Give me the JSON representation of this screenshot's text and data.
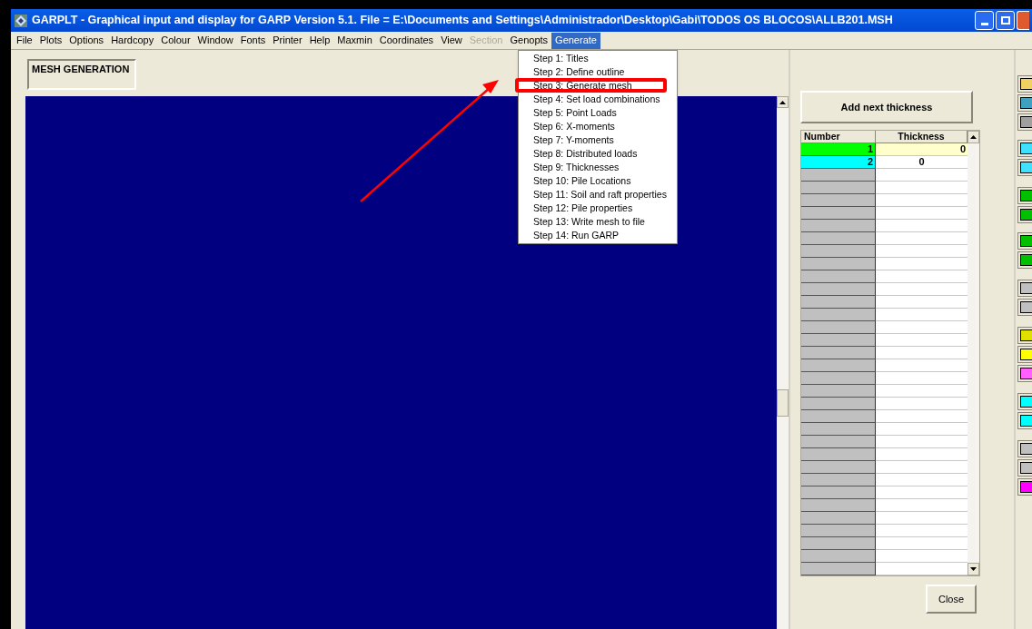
{
  "window": {
    "title": "GARPLT - Graphical input and display for GARP Version 5.1. File = E:\\Documents and Settings\\Administrador\\Desktop\\Gabi\\TODOS OS BLOCOS\\ALLB201.MSH"
  },
  "menu": [
    {
      "label": "File",
      "disabled": false,
      "selected": false
    },
    {
      "label": "Plots",
      "disabled": false,
      "selected": false
    },
    {
      "label": "Options",
      "disabled": false,
      "selected": false
    },
    {
      "label": "Hardcopy",
      "disabled": false,
      "selected": false
    },
    {
      "label": "Colour",
      "disabled": false,
      "selected": false
    },
    {
      "label": "Window",
      "disabled": false,
      "selected": false
    },
    {
      "label": "Fonts",
      "disabled": false,
      "selected": false
    },
    {
      "label": "Printer",
      "disabled": false,
      "selected": false
    },
    {
      "label": "Help",
      "disabled": false,
      "selected": false
    },
    {
      "label": "Maxmin",
      "disabled": false,
      "selected": false
    },
    {
      "label": "Coordinates",
      "disabled": false,
      "selected": false
    },
    {
      "label": "View",
      "disabled": false,
      "selected": false
    },
    {
      "label": "Section",
      "disabled": true,
      "selected": false
    },
    {
      "label": "Genopts",
      "disabled": false,
      "selected": false
    },
    {
      "label": "Generate",
      "disabled": false,
      "selected": true
    }
  ],
  "dropdown": [
    "Step 1: Titles",
    "Step 2: Define outline",
    "Step 3: Generate mesh",
    "Step 4: Set load combinations",
    "Step 5: Point Loads",
    "Step 6: X-moments",
    "Step 7: Y-moments",
    "Step 8: Distributed loads",
    "Step 9: Thicknesses",
    "Step 10: Pile Locations",
    "Step 11: Soil and raft properties",
    "Step 12: Pile properties",
    "Step 13: Write mesh to file",
    "Step 14: Run GARP"
  ],
  "panel_label": "MESH GENERATION",
  "add_button": "Add next thickness",
  "table": {
    "columns": [
      "Number",
      "Thickness"
    ],
    "rows": [
      {
        "number": "1",
        "thickness": "0",
        "color": "#00ff00",
        "selected": true
      },
      {
        "number": "2",
        "thickness": "0",
        "color": "#00ffff",
        "selected": false
      }
    ]
  },
  "close_button": "Close"
}
